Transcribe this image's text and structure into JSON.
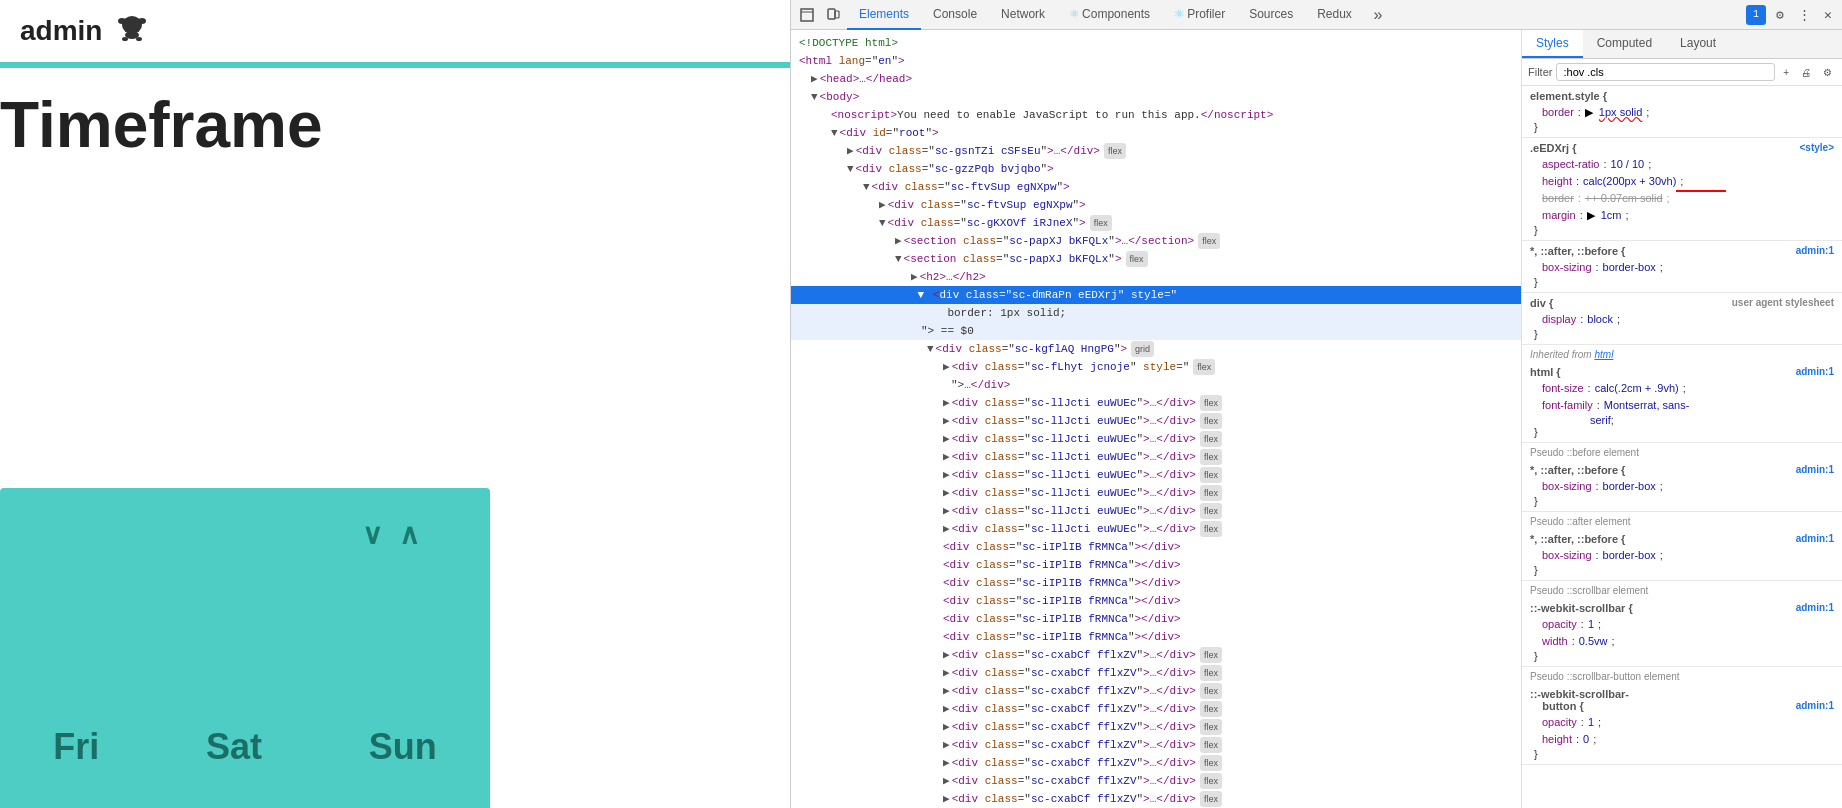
{
  "left": {
    "admin_title": "admin",
    "github_icon": "🐙",
    "timeframe": "Timeframe",
    "days": [
      "Fri",
      "Sat",
      "Sun"
    ],
    "chevron_down": "∨",
    "chevron_up": "∧"
  },
  "devtools": {
    "tabs": [
      {
        "label": "Elements",
        "active": true,
        "icon": ""
      },
      {
        "label": "Console",
        "active": false,
        "icon": ""
      },
      {
        "label": "Network",
        "active": false,
        "icon": ""
      },
      {
        "label": "Components",
        "active": false,
        "icon": "⚛"
      },
      {
        "label": "Profiler",
        "active": false,
        "icon": "⚛"
      },
      {
        "label": "Sources",
        "active": false,
        "icon": ""
      },
      {
        "label": "Redux",
        "active": false,
        "icon": ""
      }
    ],
    "more_tabs": "»",
    "right_icons": [
      "1",
      "⚙",
      "⋮",
      "✕"
    ]
  },
  "dom": {
    "lines": [
      {
        "text": "<!DOCTYPE html>",
        "indent": 0,
        "type": "comment"
      },
      {
        "text": "<html lang=\"en\">",
        "indent": 0,
        "type": "tag"
      },
      {
        "text": "▶ <head>…</head>",
        "indent": 1,
        "type": "collapsed"
      },
      {
        "text": "▼ <body>",
        "indent": 1,
        "type": "open"
      },
      {
        "text": "<noscript>You need to enable JavaScript to run this app.</noscript>",
        "indent": 2,
        "type": "tag"
      },
      {
        "text": "▼ <div id=\"root\">",
        "indent": 2,
        "type": "open"
      },
      {
        "text": "▶ <div class=\"sc-gsnTZi cSFsEu\">…</div>",
        "indent": 3,
        "type": "collapsed",
        "badge": "flex"
      },
      {
        "text": "▼ <div class=\"sc-gzzPqb bvjqbo\">",
        "indent": 3,
        "type": "open"
      },
      {
        "text": "▼ <div class=\"sc-ftvSup egNXpw\">",
        "indent": 4,
        "type": "open"
      },
      {
        "text": "▶ <div class=\"sc-ftvSup egNXpw\">",
        "indent": 5,
        "type": "collapsed"
      },
      {
        "text": "▼ <div class=\"sc-gKXOVf iRJneX\">",
        "indent": 5,
        "type": "open",
        "badge": "flex"
      },
      {
        "text": "▶ <section class=\"sc-papXJ bKFQLx\">…</section>",
        "indent": 6,
        "type": "collapsed",
        "badge": "flex"
      },
      {
        "text": "▼ <section class=\"sc-papXJ bKFQLx\">",
        "indent": 6,
        "type": "open",
        "badge": "flex"
      },
      {
        "text": "▶ <h2>…</h2>",
        "indent": 7,
        "type": "collapsed"
      },
      {
        "text": "▼ <div class=\"sc-dmRaPn eEDXrj\" style=\"",
        "indent": 7,
        "type": "selected",
        "style_val": "border: 1px solid;"
      },
      {
        "text": "\"> == $0",
        "indent": 8,
        "type": "equals"
      },
      {
        "text": "▼ <div class=\"sc-kgflAQ HngPG\">",
        "indent": 8,
        "type": "open",
        "badge": "grid"
      },
      {
        "text": "▶ <div class=\"sc-fLhyt jcnoje\" style=\"",
        "indent": 9,
        "type": "collapsed",
        "badge2": "flex"
      },
      {
        "text": "\">…</div>",
        "indent": 10,
        "type": "close"
      },
      {
        "text": "▶ <div class=\"sc-llJcti euWUEc\">…</div>",
        "indent": 9,
        "type": "collapsed",
        "badge": "flex"
      },
      {
        "text": "▶ <div class=\"sc-llJcti euWUEc\">…</div>",
        "indent": 9,
        "type": "collapsed",
        "badge": "flex"
      },
      {
        "text": "▶ <div class=\"sc-llJcti euWUEc\">…</div>",
        "indent": 9,
        "type": "collapsed",
        "badge": "flex"
      },
      {
        "text": "▶ <div class=\"sc-llJcti euWUEc\">…</div>",
        "indent": 9,
        "type": "collapsed",
        "badge": "flex"
      },
      {
        "text": "▶ <div class=\"sc-llJcti euWUEc\">…</div>",
        "indent": 9,
        "type": "collapsed",
        "badge": "flex"
      },
      {
        "text": "▶ <div class=\"sc-llJcti euWUEc\">…</div>",
        "indent": 9,
        "type": "collapsed",
        "badge": "flex"
      },
      {
        "text": "▶ <div class=\"sc-llJcti euWUEc\">…</div>",
        "indent": 9,
        "type": "collapsed",
        "badge": "flex"
      },
      {
        "text": "▶ <div class=\"sc-llJcti euWUEc\">…</div>",
        "indent": 9,
        "type": "collapsed",
        "badge": "flex"
      },
      {
        "text": "<div class=\"sc-iIPlIB fRMNCa\"></div>",
        "indent": 9,
        "type": "tag"
      },
      {
        "text": "<div class=\"sc-iIPlIB fRMNCa\"></div>",
        "indent": 9,
        "type": "tag"
      },
      {
        "text": "<div class=\"sc-iIPlIB fRMNCa\"></div>",
        "indent": 9,
        "type": "tag"
      },
      {
        "text": "<div class=\"sc-iIPlIB fRMNCa\"></div>",
        "indent": 9,
        "type": "tag"
      },
      {
        "text": "<div class=\"sc-iIPlIB fRMNCa\"></div>",
        "indent": 9,
        "type": "tag"
      },
      {
        "text": "<div class=\"sc-iIPlIB fRMNCa\"></div>",
        "indent": 9,
        "type": "tag"
      },
      {
        "text": "▶ <div class=\"sc-cxabCf fflxZV\">…</div>",
        "indent": 9,
        "type": "collapsed",
        "badge": "flex"
      },
      {
        "text": "▶ <div class=\"sc-cxabCf fflxZV\">…</div>",
        "indent": 9,
        "type": "collapsed",
        "badge": "flex"
      },
      {
        "text": "▶ <div class=\"sc-cxabCf fflxZV\">…</div>",
        "indent": 9,
        "type": "collapsed",
        "badge": "flex"
      },
      {
        "text": "▶ <div class=\"sc-cxabCf fflxZV\">…</div>",
        "indent": 9,
        "type": "collapsed",
        "badge": "flex"
      },
      {
        "text": "▶ <div class=\"sc-cxabCf fflxZV\">…</div>",
        "indent": 9,
        "type": "collapsed",
        "badge": "flex"
      },
      {
        "text": "▶ <div class=\"sc-cxabCf fflxZV\">…</div>",
        "indent": 9,
        "type": "collapsed",
        "badge": "flex"
      },
      {
        "text": "▶ <div class=\"sc-cxabCf fflxZV\">…</div>",
        "indent": 9,
        "type": "collapsed",
        "badge": "flex"
      },
      {
        "text": "▶ <div class=\"sc-cxabCf fflxZV\">…</div>",
        "indent": 9,
        "type": "collapsed",
        "badge": "flex"
      },
      {
        "text": "▶ <div class=\"sc-cxabCf fflxZV\">…</div>",
        "indent": 9,
        "type": "collapsed",
        "badge": "flex"
      }
    ]
  },
  "styles": {
    "subtabs": [
      "Styles",
      "Computed",
      "Layout"
    ],
    "filter_placeholder": ":hov .cls",
    "filter_buttons": [
      "+",
      "🖨",
      "⚙"
    ],
    "blocks": [
      {
        "selector": "element.style {",
        "source": "",
        "props": [
          {
            "name": "border",
            "colon": ":",
            "value": "▶ 1px solid;",
            "underline": true
          }
        ],
        "close": "}"
      },
      {
        "selector": ".eEDXrj {",
        "source": "<style>",
        "props": [
          {
            "name": "aspect-ratio",
            "colon": ":",
            "value": "10 / 10;"
          },
          {
            "name": "height",
            "colon": ":",
            "value": "calc(200px + 30vh);"
          },
          {
            "name": "border",
            "colon": ":",
            "value": "++ 0.07cm solid;",
            "strikethrough": true
          },
          {
            "name": "margin",
            "colon": ":",
            "value": "▶ 1cm;"
          }
        ],
        "close": "}"
      },
      {
        "selector": "*, ::after, ::before {",
        "source": "admin:1",
        "props": [
          {
            "name": "box-sizing",
            "colon": ":",
            "value": "border-box;"
          }
        ],
        "close": "}"
      },
      {
        "selector": "div {",
        "source": "user agent stylesheet",
        "props": [
          {
            "name": "display",
            "colon": ":",
            "value": "block;"
          }
        ],
        "close": "}"
      },
      {
        "inherited_from": "html",
        "selector": "html {",
        "source": "admin:1",
        "props": [
          {
            "name": "font-size",
            "colon": ":",
            "value": "calc(.2cm + .9vh);"
          },
          {
            "name": "font-family",
            "colon": ":",
            "value": "Montserrat, sans-serif;"
          }
        ],
        "close": "}"
      }
    ],
    "pseudo_sections": [
      {
        "label": "Pseudo ::before element",
        "selector": "*, ::after, ::before {",
        "source": "admin:1",
        "props": [
          {
            "name": "box-sizing",
            "colon": ":",
            "value": "border-box;"
          }
        ],
        "close": "}"
      },
      {
        "label": "Pseudo ::after element",
        "selector": "*, ::after, ::before {",
        "source": "admin:1",
        "props": [
          {
            "name": "box-sizing",
            "colon": ":",
            "value": "border-box;"
          }
        ],
        "close": "}"
      },
      {
        "label": "Pseudo ::scrollbar element",
        "selector": "::-webkit-scrollbar {",
        "source": "admin:1",
        "props": [
          {
            "name": "opacity",
            "colon": ":",
            "value": "1;"
          },
          {
            "name": "width",
            "colon": ":",
            "value": "0.5vw;"
          }
        ],
        "close": "}"
      },
      {
        "label": "Pseudo ::scrollbar-button element",
        "selector": "::-webkit-scrollbar-button {",
        "source": "admin:1",
        "props": [
          {
            "name": "opacity",
            "colon": ":",
            "value": "1;"
          },
          {
            "name": "height",
            "colon": ":",
            "value": "0;"
          }
        ],
        "close": "}"
      }
    ]
  }
}
